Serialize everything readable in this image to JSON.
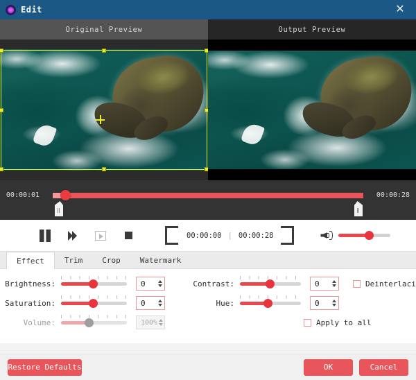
{
  "window": {
    "title": "Edit",
    "app_icon": "target-icon",
    "close_label": "✕",
    "titlebar_color": "#1b5886"
  },
  "preview": {
    "original_label": "Original Preview",
    "output_label": "Output Preview",
    "crop_overlay_color": "#e8ee2a"
  },
  "timeline": {
    "start_time": "00:00:01",
    "end_time": "00:00:28",
    "track_color": "#e8565c",
    "playhead_color": "#ea3c3c"
  },
  "controls": {
    "pause": "pause-button",
    "next_frame": "next-frame-button",
    "snapshot": "snapshot-button",
    "stop": "stop-button",
    "mark_in": "mark-in-button",
    "mark_out": "mark-out-button",
    "current_time": "00:00:00",
    "total_time": "00:00:28",
    "time_separator": "|",
    "volume_icon": "speaker-icon"
  },
  "tabs": [
    {
      "label": "Effect",
      "active": true
    },
    {
      "label": "Trim",
      "active": false
    },
    {
      "label": "Crop",
      "active": false
    },
    {
      "label": "Watermark",
      "active": false
    }
  ],
  "effect": {
    "brightness": {
      "label": "Brightness:",
      "value": "0"
    },
    "contrast": {
      "label": "Contrast:",
      "value": "0"
    },
    "saturation": {
      "label": "Saturation:",
      "value": "0"
    },
    "hue": {
      "label": "Hue:",
      "value": "0"
    },
    "volume": {
      "label": "Volume:",
      "value": "100%",
      "disabled": true
    },
    "deinterlacing": {
      "label": "Deinterlacing",
      "checked": false
    },
    "apply_to_all": {
      "label": "Apply to all",
      "checked": false
    },
    "accent_color": "#e8474e"
  },
  "footer": {
    "restore_label": "Restore Defaults",
    "ok_label": "OK",
    "cancel_label": "Cancel",
    "button_color": "#e8565c"
  }
}
